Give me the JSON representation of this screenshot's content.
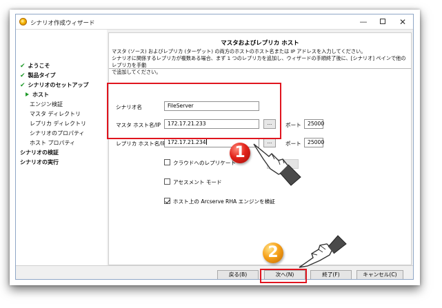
{
  "window": {
    "title": "シナリオ作成ウィザード",
    "minimize_glyph": "—",
    "close_glyph": "✕"
  },
  "sidebar": {
    "items": [
      {
        "label": "ようこそ",
        "state": "done"
      },
      {
        "label": "製品タイプ",
        "state": "done"
      },
      {
        "label": "シナリオのセットアップ",
        "state": "done"
      },
      {
        "label": "ホスト",
        "state": "current"
      },
      {
        "label": "エンジン検証",
        "state": "sub"
      },
      {
        "label": "マスタ ディレクトリ",
        "state": "sub"
      },
      {
        "label": "レプリカ ディレクトリ",
        "state": "sub"
      },
      {
        "label": "シナリオのプロパティ",
        "state": "sub"
      },
      {
        "label": "ホスト プロパティ",
        "state": "sub"
      },
      {
        "label": "シナリオの検証",
        "state": "top"
      },
      {
        "label": "シナリオの実行",
        "state": "top"
      }
    ],
    "check_glyph": "✔"
  },
  "main": {
    "title": "マスタおよびレプリカ ホスト",
    "description_lines": [
      "マスタ (ソース) およびレプリカ (ターゲット) の両方のホストのホスト名または IP アドレスを入力してください。",
      "シナリオに関係するレプリカが複数ある場合、まず 1 つのレプリカを追加し、ウィザードの手順終了後に、[シナリオ] ペインで他のレプリカを手動",
      "で追加してください。"
    ],
    "form": {
      "scenario_name_label": "シナリオ名",
      "scenario_name_value": "FileServer",
      "master_label": "マスタ ホスト名/IP",
      "master_value": "172.17.21.233",
      "replica_label": "レプリカ ホスト名/IP",
      "replica_value": "172.17.21.234",
      "browse_label": "...",
      "port_label": "ポート",
      "master_port": "25000",
      "replica_port": "25000"
    },
    "options": [
      {
        "label": "クラウドへのレプリケート",
        "checked": false
      },
      {
        "label": "アセスメント モード",
        "checked": false
      },
      {
        "label": "ホスト上の Arcserve RHA エンジンを検証",
        "checked": true
      }
    ]
  },
  "footer": {
    "back_label": "戻る(B)",
    "next_label": "次へ(N)",
    "finish_label": "終了(F)",
    "cancel_label": "キャンセル(C)"
  },
  "annotations": {
    "badge1": "1",
    "badge2": "2",
    "highlight_color": "#e0141e"
  }
}
